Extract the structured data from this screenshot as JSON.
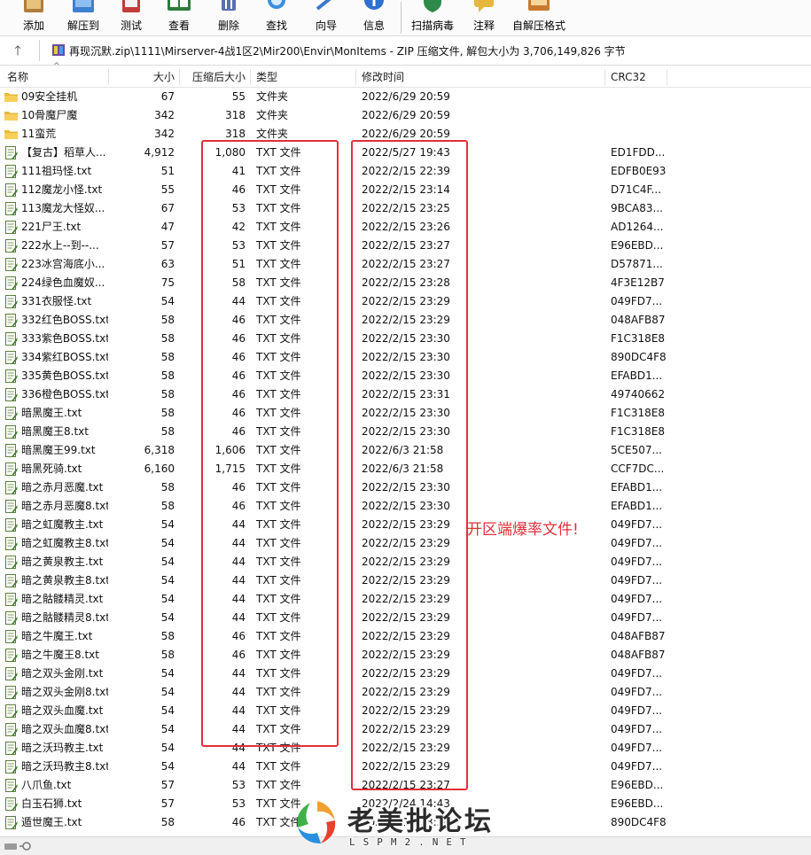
{
  "toolbar": {
    "buttons": [
      {
        "label": "添加",
        "icon": "add-archive-icon"
      },
      {
        "label": "解压到",
        "icon": "extract-to-icon"
      },
      {
        "label": "测试",
        "icon": "test-icon"
      },
      {
        "label": "查看",
        "icon": "view-icon"
      },
      {
        "label": "删除",
        "icon": "delete-icon"
      },
      {
        "label": "查找",
        "icon": "find-icon"
      },
      {
        "label": "向导",
        "icon": "wizard-icon"
      },
      {
        "label": "信息",
        "icon": "info-icon"
      },
      {
        "label": "扫描病毒",
        "icon": "virus-scan-icon"
      },
      {
        "label": "注释",
        "icon": "comment-icon"
      },
      {
        "label": "自解压格式",
        "icon": "sfx-icon"
      }
    ]
  },
  "addressbar": {
    "path": "再现沉默.zip\\1111\\Mirserver-4战1区2\\Mir200\\Envir\\MonItems - ZIP 压缩文件, 解包大小为 3,706,149,826 字节"
  },
  "columns": {
    "name": "名称",
    "size": "大小",
    "packed": "压缩后大小",
    "type": "类型",
    "modified": "修改时间",
    "crc": "CRC32"
  },
  "files": [
    {
      "name": "09安全挂机",
      "size": "67",
      "packed": "55",
      "type": "文件夹",
      "modified": "2022/6/29 20:59",
      "crc": "",
      "kind": "folder"
    },
    {
      "name": "10骨魔尸魔",
      "size": "342",
      "packed": "318",
      "type": "文件夹",
      "modified": "2022/6/29 20:59",
      "crc": "",
      "kind": "folder"
    },
    {
      "name": "11蛮荒",
      "size": "342",
      "packed": "318",
      "type": "文件夹",
      "modified": "2022/6/29 20:59",
      "crc": "",
      "kind": "folder"
    },
    {
      "name": "【复古】稻草人...",
      "size": "4,912",
      "packed": "1,080",
      "type": "TXT 文件",
      "modified": "2022/5/27 19:43",
      "crc": "ED1FDD...",
      "kind": "txt"
    },
    {
      "name": "111祖玛怪.txt",
      "size": "51",
      "packed": "41",
      "type": "TXT 文件",
      "modified": "2022/2/15 22:39",
      "crc": "EDFB0E93",
      "kind": "txt"
    },
    {
      "name": "112魔龙小怪.txt",
      "size": "55",
      "packed": "46",
      "type": "TXT 文件",
      "modified": "2022/2/15 23:14",
      "crc": "D71C4F...",
      "kind": "txt"
    },
    {
      "name": "113魔龙大怪奴...",
      "size": "67",
      "packed": "53",
      "type": "TXT 文件",
      "modified": "2022/2/15 23:25",
      "crc": "9BCA83...",
      "kind": "txt"
    },
    {
      "name": "221尸王.txt",
      "size": "47",
      "packed": "42",
      "type": "TXT 文件",
      "modified": "2022/2/15 23:26",
      "crc": "AD1264...",
      "kind": "txt"
    },
    {
      "name": "222水上--到--...",
      "size": "57",
      "packed": "53",
      "type": "TXT 文件",
      "modified": "2022/2/15 23:27",
      "crc": "E96EBD...",
      "kind": "txt"
    },
    {
      "name": "223冰宫海底小...",
      "size": "63",
      "packed": "51",
      "type": "TXT 文件",
      "modified": "2022/2/15 23:27",
      "crc": "D57871...",
      "kind": "txt"
    },
    {
      "name": "224绿色血魔奴...",
      "size": "75",
      "packed": "58",
      "type": "TXT 文件",
      "modified": "2022/2/15 23:28",
      "crc": "4F3E12B7",
      "kind": "txt"
    },
    {
      "name": "331衣服怪.txt",
      "size": "54",
      "packed": "44",
      "type": "TXT 文件",
      "modified": "2022/2/15 23:29",
      "crc": "049FD7...",
      "kind": "txt"
    },
    {
      "name": "332红色BOSS.txt",
      "size": "58",
      "packed": "46",
      "type": "TXT 文件",
      "modified": "2022/2/15 23:29",
      "crc": "048AFB87",
      "kind": "txt"
    },
    {
      "name": "333紫色BOSS.txt",
      "size": "58",
      "packed": "46",
      "type": "TXT 文件",
      "modified": "2022/2/15 23:30",
      "crc": "F1C318E8",
      "kind": "txt"
    },
    {
      "name": "334紫红BOSS.txt",
      "size": "58",
      "packed": "46",
      "type": "TXT 文件",
      "modified": "2022/2/15 23:30",
      "crc": "890DC4F8",
      "kind": "txt"
    },
    {
      "name": "335黄色BOSS.txt",
      "size": "58",
      "packed": "46",
      "type": "TXT 文件",
      "modified": "2022/2/15 23:30",
      "crc": "EFABD1...",
      "kind": "txt"
    },
    {
      "name": "336橙色BOSS.txt",
      "size": "58",
      "packed": "46",
      "type": "TXT 文件",
      "modified": "2022/2/15 23:31",
      "crc": "49740662",
      "kind": "txt"
    },
    {
      "name": "暗黑魔王.txt",
      "size": "58",
      "packed": "46",
      "type": "TXT 文件",
      "modified": "2022/2/15 23:30",
      "crc": "F1C318E8",
      "kind": "txt"
    },
    {
      "name": "暗黑魔王8.txt",
      "size": "58",
      "packed": "46",
      "type": "TXT 文件",
      "modified": "2022/2/15 23:30",
      "crc": "F1C318E8",
      "kind": "txt"
    },
    {
      "name": "暗黑魔王99.txt",
      "size": "6,318",
      "packed": "1,606",
      "type": "TXT 文件",
      "modified": "2022/6/3 21:58",
      "crc": "5CE507...",
      "kind": "txt"
    },
    {
      "name": "暗黑死骑.txt",
      "size": "6,160",
      "packed": "1,715",
      "type": "TXT 文件",
      "modified": "2022/6/3 21:58",
      "crc": "CCF7DC...",
      "kind": "txt"
    },
    {
      "name": "暗之赤月恶魔.txt",
      "size": "58",
      "packed": "46",
      "type": "TXT 文件",
      "modified": "2022/2/15 23:30",
      "crc": "EFABD1...",
      "kind": "txt"
    },
    {
      "name": "暗之赤月恶魔8.txt",
      "size": "58",
      "packed": "46",
      "type": "TXT 文件",
      "modified": "2022/2/15 23:30",
      "crc": "EFABD1...",
      "kind": "txt"
    },
    {
      "name": "暗之虹魔教主.txt",
      "size": "54",
      "packed": "44",
      "type": "TXT 文件",
      "modified": "2022/2/15 23:29",
      "crc": "049FD7...",
      "kind": "txt"
    },
    {
      "name": "暗之虹魔教主8.txt",
      "size": "54",
      "packed": "44",
      "type": "TXT 文件",
      "modified": "2022/2/15 23:29",
      "crc": "049FD7...",
      "kind": "txt"
    },
    {
      "name": "暗之黄泉教主.txt",
      "size": "54",
      "packed": "44",
      "type": "TXT 文件",
      "modified": "2022/2/15 23:29",
      "crc": "049FD7...",
      "kind": "txt"
    },
    {
      "name": "暗之黄泉教主8.txt",
      "size": "54",
      "packed": "44",
      "type": "TXT 文件",
      "modified": "2022/2/15 23:29",
      "crc": "049FD7...",
      "kind": "txt"
    },
    {
      "name": "暗之骷髅精灵.txt",
      "size": "54",
      "packed": "44",
      "type": "TXT 文件",
      "modified": "2022/2/15 23:29",
      "crc": "049FD7...",
      "kind": "txt"
    },
    {
      "name": "暗之骷髅精灵8.txt",
      "size": "54",
      "packed": "44",
      "type": "TXT 文件",
      "modified": "2022/2/15 23:29",
      "crc": "049FD7...",
      "kind": "txt"
    },
    {
      "name": "暗之牛魔王.txt",
      "size": "58",
      "packed": "46",
      "type": "TXT 文件",
      "modified": "2022/2/15 23:29",
      "crc": "048AFB87",
      "kind": "txt"
    },
    {
      "name": "暗之牛魔王8.txt",
      "size": "58",
      "packed": "46",
      "type": "TXT 文件",
      "modified": "2022/2/15 23:29",
      "crc": "048AFB87",
      "kind": "txt"
    },
    {
      "name": "暗之双头金刚.txt",
      "size": "54",
      "packed": "44",
      "type": "TXT 文件",
      "modified": "2022/2/15 23:29",
      "crc": "049FD7...",
      "kind": "txt"
    },
    {
      "name": "暗之双头金刚8.txt",
      "size": "54",
      "packed": "44",
      "type": "TXT 文件",
      "modified": "2022/2/15 23:29",
      "crc": "049FD7...",
      "kind": "txt"
    },
    {
      "name": "暗之双头血魔.txt",
      "size": "54",
      "packed": "44",
      "type": "TXT 文件",
      "modified": "2022/2/15 23:29",
      "crc": "049FD7...",
      "kind": "txt"
    },
    {
      "name": "暗之双头血魔8.txt",
      "size": "54",
      "packed": "44",
      "type": "TXT 文件",
      "modified": "2022/2/15 23:29",
      "crc": "049FD7...",
      "kind": "txt"
    },
    {
      "name": "暗之沃玛教主.txt",
      "size": "54",
      "packed": "44",
      "type": "TXT 文件",
      "modified": "2022/2/15 23:29",
      "crc": "049FD7...",
      "kind": "txt"
    },
    {
      "name": "暗之沃玛教主8.txt",
      "size": "54",
      "packed": "44",
      "type": "TXT 文件",
      "modified": "2022/2/15 23:29",
      "crc": "049FD7...",
      "kind": "txt"
    },
    {
      "name": "八爪鱼.txt",
      "size": "57",
      "packed": "53",
      "type": "TXT 文件",
      "modified": "2022/2/15 23:27",
      "crc": "E96EBD...",
      "kind": "txt"
    },
    {
      "name": "白玉石狮.txt",
      "size": "57",
      "packed": "53",
      "type": "TXT 文件",
      "modified": "2022/2/24 14:43",
      "crc": "E96EBD...",
      "kind": "txt"
    },
    {
      "name": "遁世魔王.txt",
      "size": "58",
      "packed": "46",
      "type": "TXT 文件",
      "modified": "2022/2/15 23:30",
      "crc": "890DC4F8",
      "kind": "txt"
    }
  ],
  "annotation": {
    "text": "开区端爆率文件!",
    "color": "#e0303a"
  },
  "watermark": {
    "title": "老美批论坛",
    "subtitle": "LSPM2.NET"
  }
}
